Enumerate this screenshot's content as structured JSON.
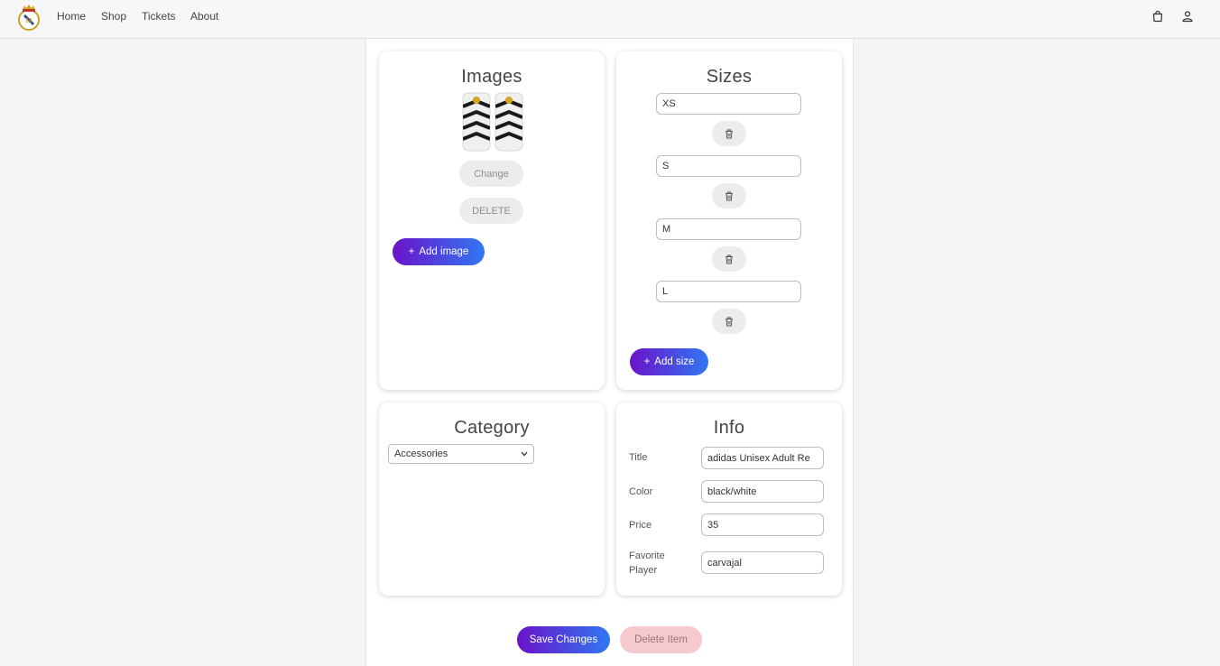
{
  "navbar": {
    "links": [
      "Home",
      "Shop",
      "Tickets",
      "About"
    ],
    "cart_icon": "shopping-bag-icon",
    "user_icon": "user-icon",
    "logo": "real-madrid-crest"
  },
  "images_card": {
    "title": "Images",
    "change_label": "Change",
    "delete_label": "DELETE",
    "add_image_label": "Add image",
    "add_icon": "+"
  },
  "sizes_card": {
    "title": "Sizes",
    "sizes": [
      "XS",
      "S",
      "M",
      "L"
    ],
    "trash_icon": "trash-icon",
    "add_size_label": "Add size",
    "add_icon": "+"
  },
  "category_card": {
    "title": "Category",
    "selected": "Accessories"
  },
  "info_card": {
    "title": "Info",
    "fields": [
      {
        "label": "Title",
        "value": "adidas Unisex Adult Re"
      },
      {
        "label": "Color",
        "value": "black/white"
      },
      {
        "label": "Price",
        "value": "35"
      },
      {
        "label": "Favorite Player",
        "value": "carvajal"
      }
    ]
  },
  "actions": {
    "save_label": "Save Changes",
    "delete_label": "Delete Item"
  },
  "colors": {
    "gradient_start": "#6a13c8",
    "gradient_end": "#3177f2",
    "delete_bg": "#f6c9cf"
  }
}
